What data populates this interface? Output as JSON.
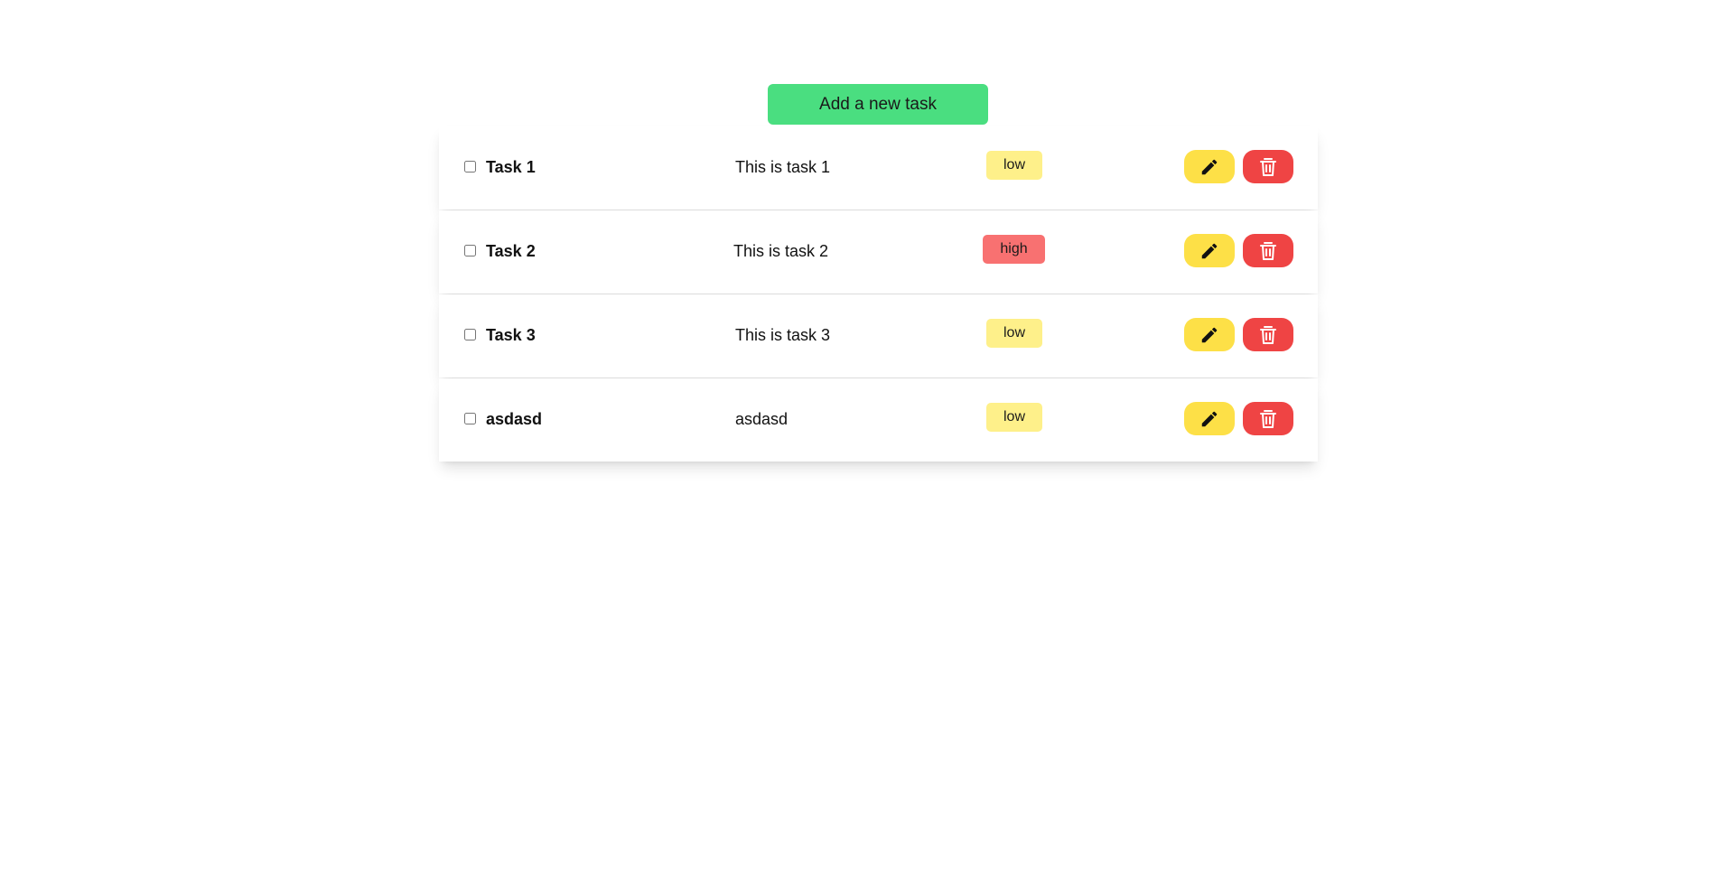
{
  "header": {
    "add_button_label": "Add a new task"
  },
  "colors": {
    "add_button": "#4ade80",
    "priority_low": "#fef08a",
    "priority_high": "#f87171",
    "edit_button": "#fde047",
    "delete_button": "#ef4444"
  },
  "tasks": [
    {
      "title": "Task 1",
      "description": "This is task 1",
      "priority": "low",
      "completed": false,
      "edit_icon": "pencil-icon",
      "delete_icon": "trash-icon"
    },
    {
      "title": "Task 2",
      "description": "This is task 2",
      "priority": "high",
      "completed": false,
      "edit_icon": "pencil-icon",
      "delete_icon": "trash-icon"
    },
    {
      "title": "Task 3",
      "description": "This is task 3",
      "priority": "low",
      "completed": false,
      "edit_icon": "pencil-icon",
      "delete_icon": "trash-icon"
    },
    {
      "title": "asdasd",
      "description": "asdasd",
      "priority": "low",
      "completed": false,
      "edit_icon": "pencil-icon",
      "delete_icon": "trash-icon"
    }
  ]
}
